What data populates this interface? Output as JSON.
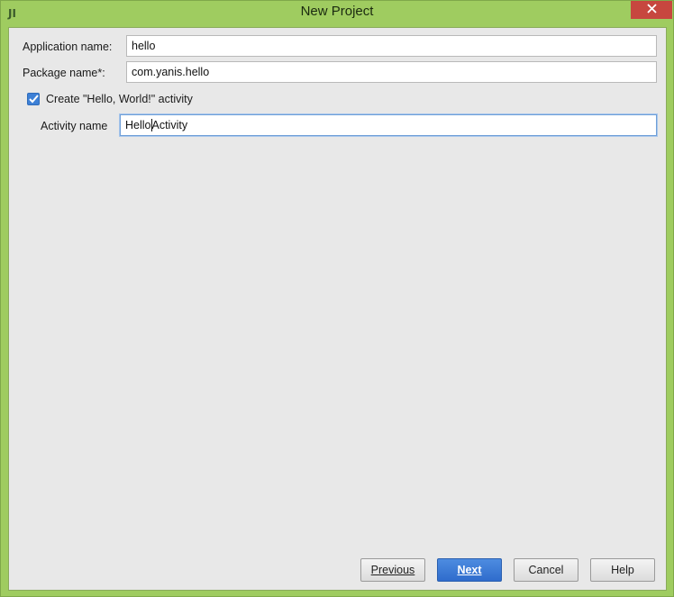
{
  "window": {
    "title": "New Project",
    "close_icon": "close-icon"
  },
  "form": {
    "app_name_label": "Application name:",
    "app_name_value": "hello",
    "package_label": "Package name*:",
    "package_value": "com.yanis.hello",
    "create_activity_label": "Create \"Hello, World!\" activity",
    "create_activity_checked": true,
    "activity_name_label": "Activity name",
    "activity_name_value_before_caret": "Hello",
    "activity_name_value_after_caret": "Activity"
  },
  "buttons": {
    "previous": "Previous",
    "next": "Next",
    "cancel": "Cancel",
    "help": "Help"
  },
  "colors": {
    "frame": "#9fcc60",
    "close": "#c7473f",
    "primary": "#2f6ccc",
    "checkbox": "#3d80d6"
  }
}
